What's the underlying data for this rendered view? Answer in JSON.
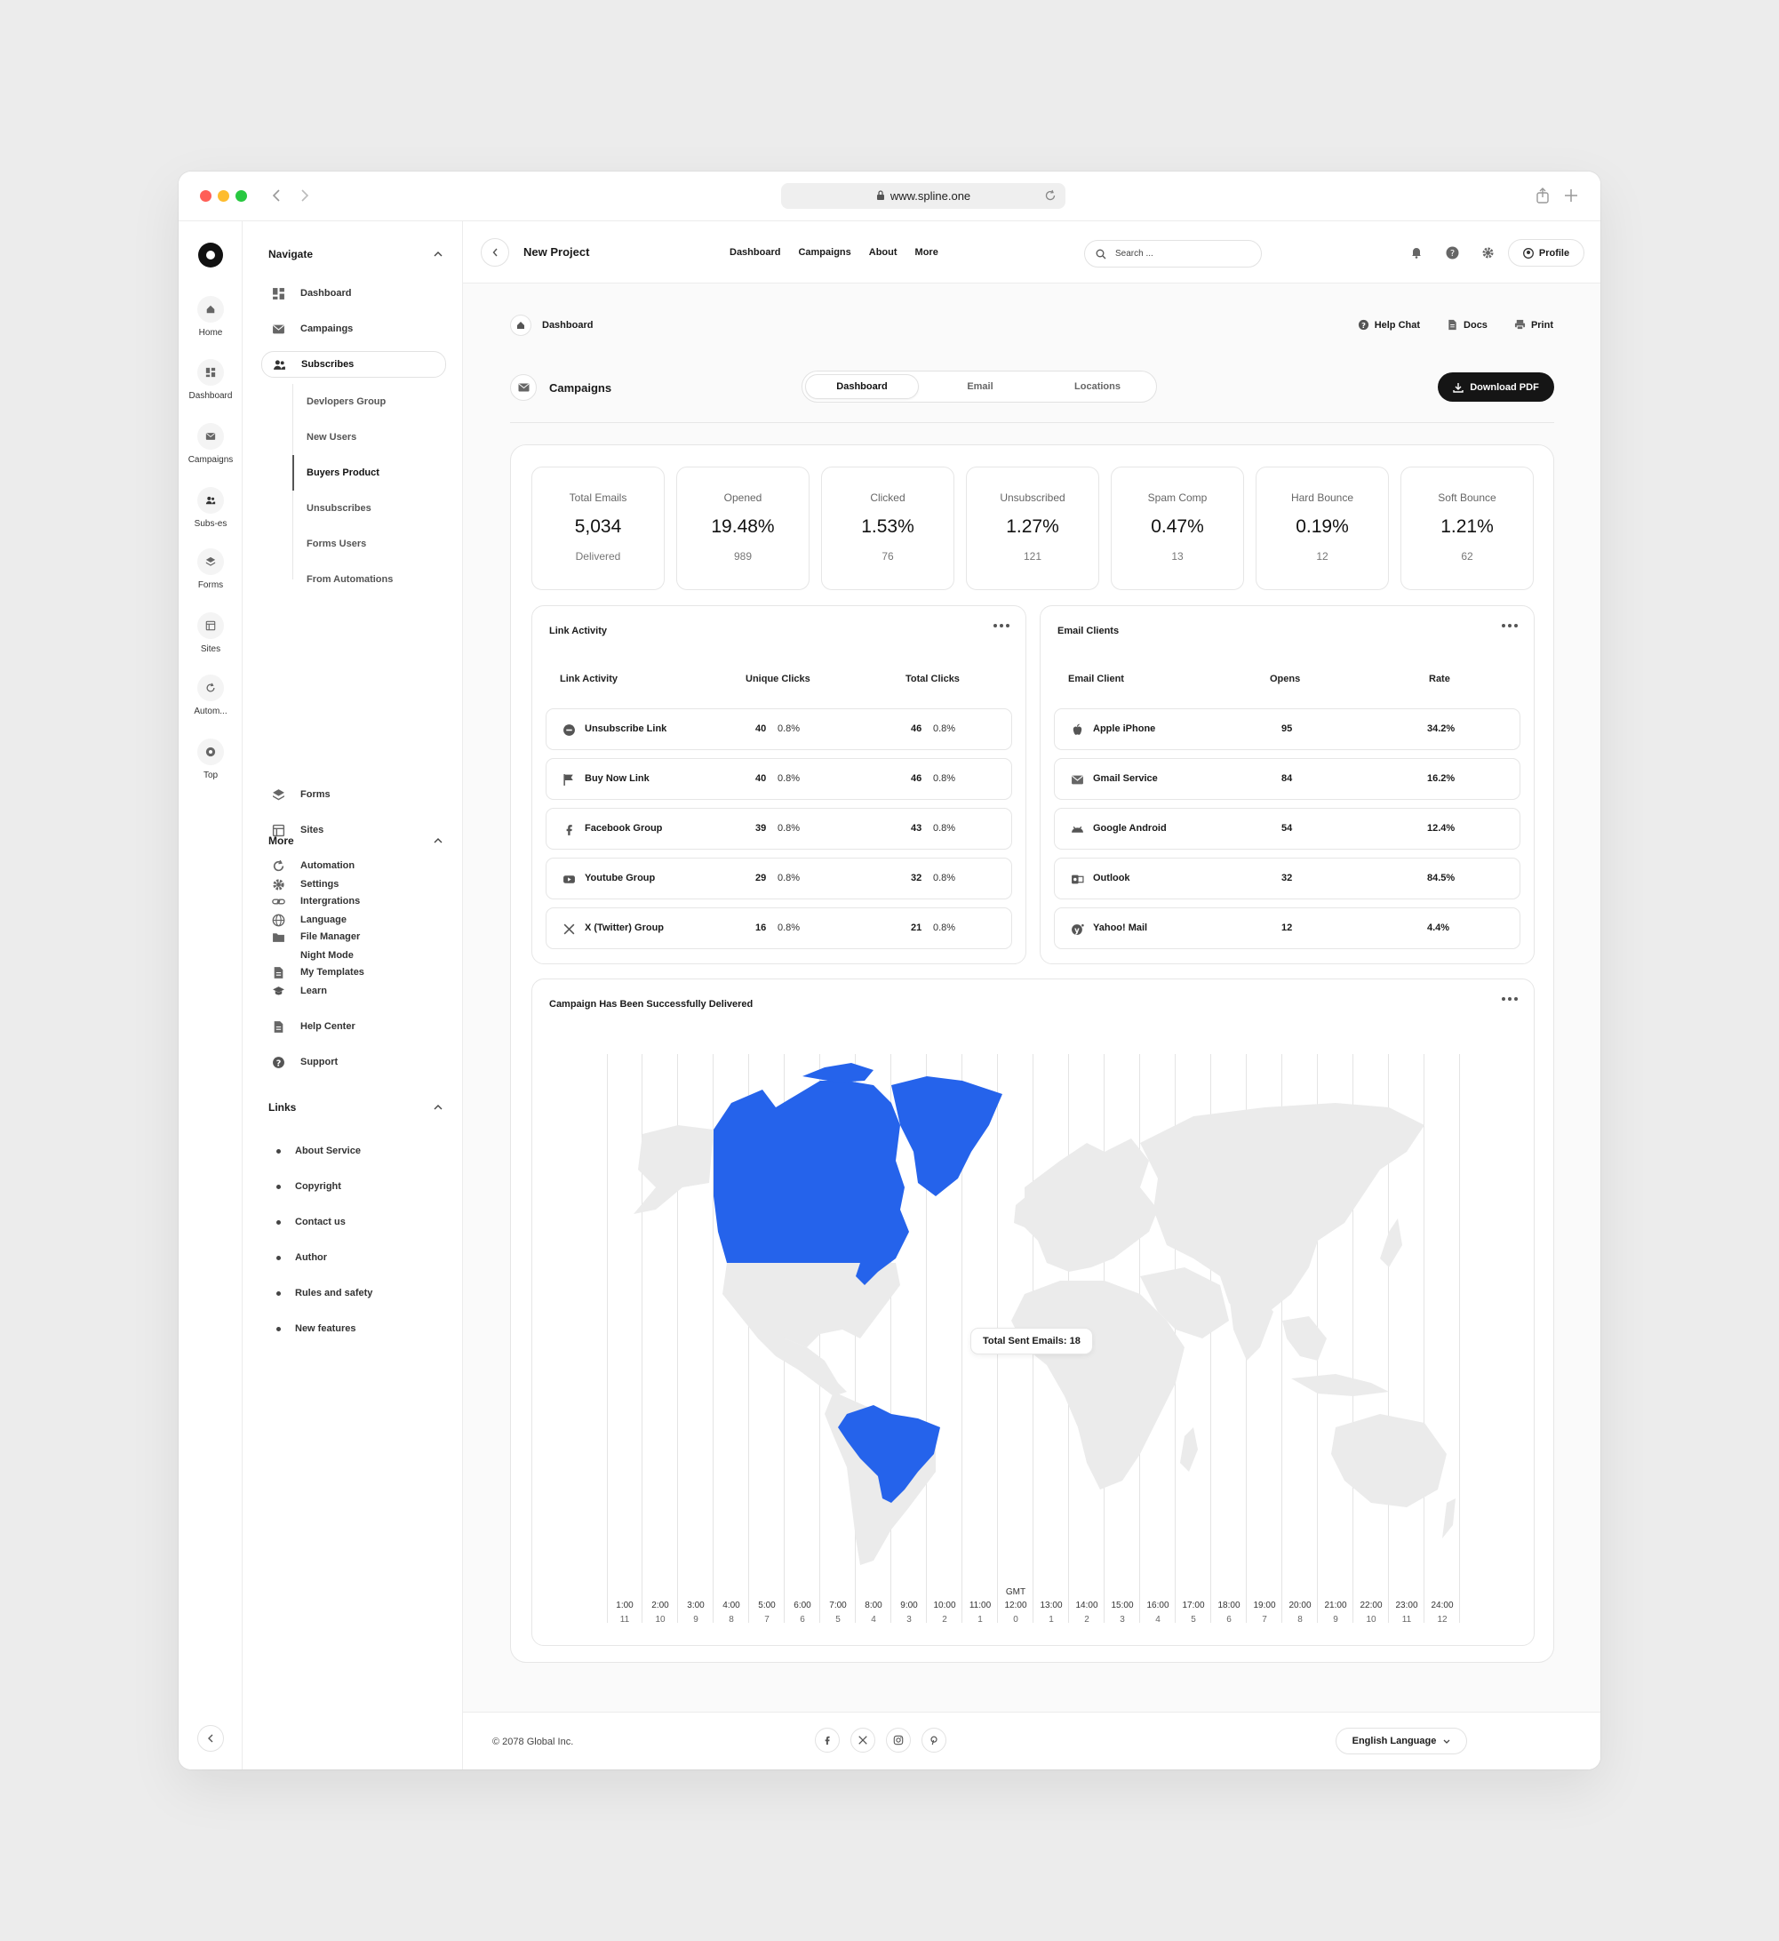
{
  "browser": {
    "url": "www.spline.one"
  },
  "rail": {
    "items": [
      {
        "label": "Home",
        "icon": "home-icon"
      },
      {
        "label": "Dashboard",
        "icon": "dashboard-icon"
      },
      {
        "label": "Campaigns",
        "icon": "mail-icon"
      },
      {
        "label": "Subs-es",
        "icon": "users-icon"
      },
      {
        "label": "Forms",
        "icon": "layers-icon"
      },
      {
        "label": "Sites",
        "icon": "sites-icon"
      },
      {
        "label": "Autom...",
        "icon": "refresh-icon"
      },
      {
        "label": "Top",
        "icon": "star-icon"
      }
    ]
  },
  "nav": {
    "navigate_title": "Navigate",
    "items": [
      {
        "label": "Dashboard",
        "icon": "dashboard-icon"
      },
      {
        "label": "Campaings",
        "icon": "mail-icon"
      },
      {
        "label": "Subscribes",
        "icon": "users-icon"
      }
    ],
    "sub_items": [
      "Devlopers Group",
      "New Users",
      "Buyers Product",
      "Unsubscribes",
      "Forms Users",
      "From Automations"
    ],
    "items2": [
      {
        "label": "Forms",
        "icon": "layers-icon"
      },
      {
        "label": "Sites",
        "icon": "sites-icon"
      },
      {
        "label": "Automation",
        "icon": "refresh-icon"
      },
      {
        "label": "Intergrations",
        "icon": "link-icon"
      },
      {
        "label": "File Manager",
        "icon": "folder-icon"
      },
      {
        "label": "My Templates",
        "icon": "file-icon"
      }
    ],
    "more_title": "More",
    "more": [
      {
        "label": "Settings",
        "icon": "gear-icon"
      },
      {
        "label": "Language",
        "icon": "globe-icon"
      },
      {
        "label": "Night Mode",
        "icon": "moon-icon"
      },
      {
        "label": "Learn",
        "icon": "graduation-icon"
      },
      {
        "label": "Help Center",
        "icon": "file-icon"
      },
      {
        "label": "Support",
        "icon": "help-icon"
      }
    ],
    "links_title": "Links",
    "links": [
      "About Service",
      "Copyright",
      "Contact us",
      "Author",
      "Rules and safety",
      "New features"
    ]
  },
  "topbar": {
    "project": "New Project",
    "menu": [
      "Dashboard",
      "Campaigns",
      "About",
      "More"
    ],
    "search_placeholder": "Search ...",
    "profile": "Profile"
  },
  "page": {
    "breadcrumb": "Dashboard",
    "actions": [
      "Help Chat",
      "Docs",
      "Print"
    ],
    "section_title": "Campaigns",
    "tabs": [
      "Dashboard",
      "Email",
      "Locations"
    ],
    "download": "Download PDF"
  },
  "stats": [
    {
      "label": "Total Emails",
      "value": "5,034",
      "sub": "Delivered"
    },
    {
      "label": "Opened",
      "value": "19.48%",
      "sub": "989"
    },
    {
      "label": "Clicked",
      "value": "1.53%",
      "sub": "76"
    },
    {
      "label": "Unsubscribed",
      "value": "1.27%",
      "sub": "121"
    },
    {
      "label": "Spam Comp",
      "value": "0.47%",
      "sub": "13"
    },
    {
      "label": "Hard Bounce",
      "value": "0.19%",
      "sub": "12"
    },
    {
      "label": "Soft Bounce",
      "value": "1.21%",
      "sub": "62"
    }
  ],
  "link_activity": {
    "title": "Link Activity",
    "headers": [
      "Link Activity",
      "Unique Clicks",
      "Total Clicks"
    ],
    "rows": [
      {
        "name": "Unsubscribe Link",
        "icon": "minus-circle-icon",
        "u": "40",
        "up": "0.8%",
        "t": "46",
        "tp": "0.8%"
      },
      {
        "name": "Buy Now Link",
        "icon": "flag-icon",
        "u": "40",
        "up": "0.8%",
        "t": "46",
        "tp": "0.8%"
      },
      {
        "name": "Facebook Group",
        "icon": "facebook-icon",
        "u": "39",
        "up": "0.8%",
        "t": "43",
        "tp": "0.8%"
      },
      {
        "name": "Youtube Group",
        "icon": "youtube-icon",
        "u": "29",
        "up": "0.8%",
        "t": "32",
        "tp": "0.8%"
      },
      {
        "name": "X (Twitter) Group",
        "icon": "x-icon",
        "u": "16",
        "up": "0.8%",
        "t": "21",
        "tp": "0.8%"
      }
    ]
  },
  "email_clients": {
    "title": "Email Clients",
    "headers": [
      "Email Client",
      "Opens",
      "Rate"
    ],
    "rows": [
      {
        "name": "Apple iPhone",
        "icon": "apple-icon",
        "opens": "95",
        "rate": "34.2%"
      },
      {
        "name": "Gmail Service",
        "icon": "mail-icon",
        "opens": "84",
        "rate": "16.2%"
      },
      {
        "name": "Google Android",
        "icon": "android-icon",
        "opens": "54",
        "rate": "12.4%"
      },
      {
        "name": "Outlook",
        "icon": "outlook-icon",
        "opens": "32",
        "rate": "84.5%"
      },
      {
        "name": "Yahoo! Mail",
        "icon": "yahoo-icon",
        "opens": "12",
        "rate": "4.4%"
      }
    ]
  },
  "map": {
    "title": "Campaign Has Been Successfully Delivered",
    "tooltip": "Total Sent Emails: 18",
    "gmt_label": "GMT",
    "highlight_color": "#2563eb",
    "highlighted_countries": [
      "Canada",
      "Greenland",
      "Brazil"
    ],
    "times": [
      "1:00",
      "2:00",
      "3:00",
      "4:00",
      "5:00",
      "6:00",
      "7:00",
      "8:00",
      "9:00",
      "10:00",
      "11:00",
      "12:00",
      "13:00",
      "14:00",
      "15:00",
      "16:00",
      "17:00",
      "18:00",
      "19:00",
      "20:00",
      "21:00",
      "22:00",
      "23:00",
      "24:00"
    ],
    "offsets": [
      "11",
      "10",
      "9",
      "8",
      "7",
      "6",
      "5",
      "4",
      "3",
      "2",
      "1",
      "0",
      "1",
      "2",
      "3",
      "4",
      "5",
      "6",
      "7",
      "8",
      "9",
      "10",
      "11",
      "12"
    ]
  },
  "footer": {
    "copyright": "© 2078 Global Inc.",
    "language": "English Language",
    "social": [
      "facebook-icon",
      "x-icon",
      "instagram-icon",
      "pinterest-icon"
    ]
  }
}
